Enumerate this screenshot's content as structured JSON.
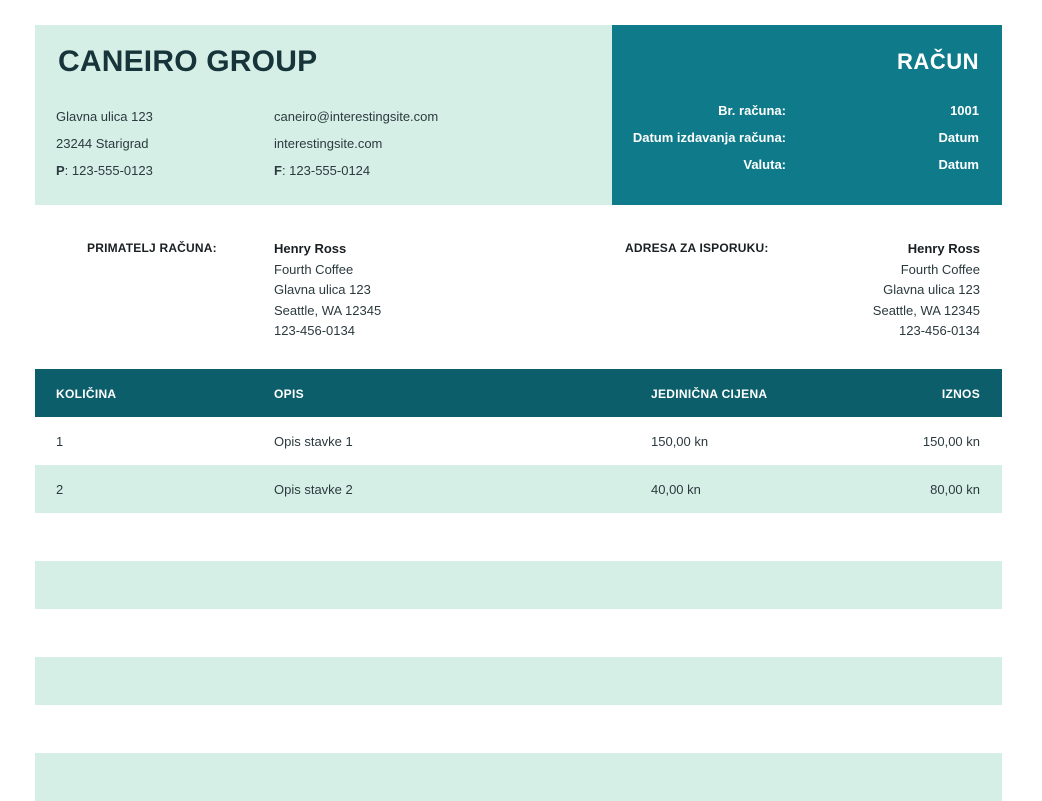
{
  "company": {
    "name": "CANEIRO GROUP",
    "address_line1": "Glavna ulica 123",
    "address_line2": "23244 Starigrad",
    "phone_label": "P",
    "phone": ": 123-555-0123",
    "email": "caneiro@interestingsite.com",
    "website": "interestingsite.com",
    "fax_label": "F",
    "fax": ": 123-555-0124"
  },
  "invoice": {
    "title": "RAČUN",
    "meta": [
      {
        "label": "Br. računa:",
        "value": "1001"
      },
      {
        "label": "Datum izdavanja računa:",
        "value": "Datum"
      },
      {
        "label": "Valuta:",
        "value": "Datum"
      }
    ]
  },
  "bill_to": {
    "label": "PRIMATELJ RAČUNA:",
    "name": "Henry Ross",
    "company": "Fourth Coffee",
    "street": "Glavna ulica 123",
    "city": "Seattle, WA 12345",
    "phone": "123-456-0134"
  },
  "ship_to": {
    "label": "ADRESA ZA ISPORUKU:",
    "name": "Henry Ross",
    "company": "Fourth Coffee",
    "street": "Glavna ulica 123",
    "city": "Seattle, WA 12345",
    "phone": "123-456-0134"
  },
  "table": {
    "headers": [
      "KOLIČINA",
      "OPIS",
      "JEDINIČNA CIJENA",
      "IZNOS"
    ],
    "rows": [
      [
        "1",
        "Opis stavke 1",
        "150,00 kn",
        "150,00 kn"
      ],
      [
        "2",
        "Opis stavke 2",
        "40,00 kn",
        "80,00 kn"
      ],
      [
        "",
        "",
        "",
        ""
      ],
      [
        "",
        "",
        "",
        ""
      ],
      [
        "",
        "",
        "",
        ""
      ],
      [
        "",
        "",
        "",
        ""
      ],
      [
        "",
        "",
        "",
        ""
      ],
      [
        "",
        "",
        "",
        ""
      ]
    ]
  },
  "colors": {
    "light_teal": "#d6efe6",
    "teal": "#0e7a8a",
    "dark_teal": "#0d5e6b"
  }
}
